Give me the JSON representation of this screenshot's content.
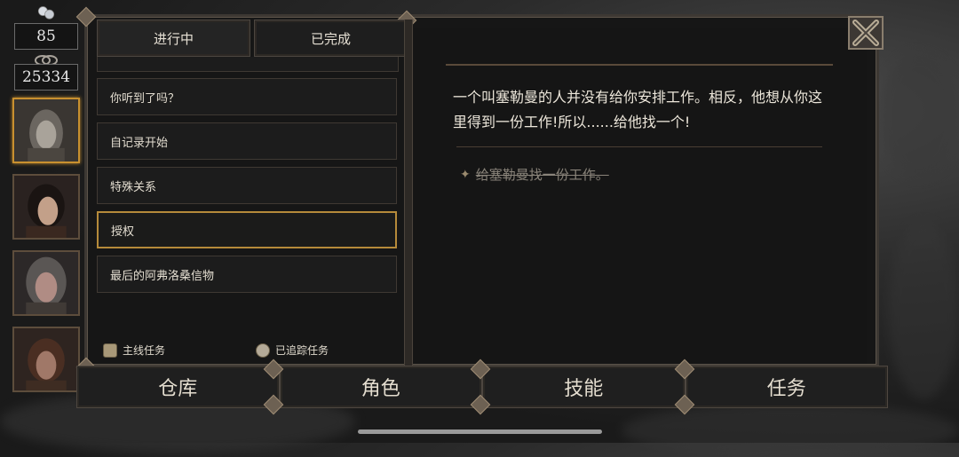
{
  "resources": {
    "pearls": "85",
    "coins": "25334"
  },
  "tabs": [
    {
      "label": "进行中"
    },
    {
      "label": "已完成"
    }
  ],
  "quests": [
    {
      "title": "你听到了吗？"
    },
    {
      "title": "自记录开始"
    },
    {
      "title": "特殊关系"
    },
    {
      "title": "授权"
    },
    {
      "title": "最后的阿弗洛桑信物"
    }
  ],
  "legend": {
    "main": "主线任务",
    "tracked": "已追踪任务"
  },
  "detail": {
    "description": "一个叫塞勒曼的人并没有给你安排工作。相反，他想从你这里得到一份工作!所以......给他找一个!",
    "objective": "给塞勒曼找一份工作。"
  },
  "bottom_nav": {
    "storage": "仓库",
    "character": "角色",
    "skills": "技能",
    "quests": "任务"
  }
}
